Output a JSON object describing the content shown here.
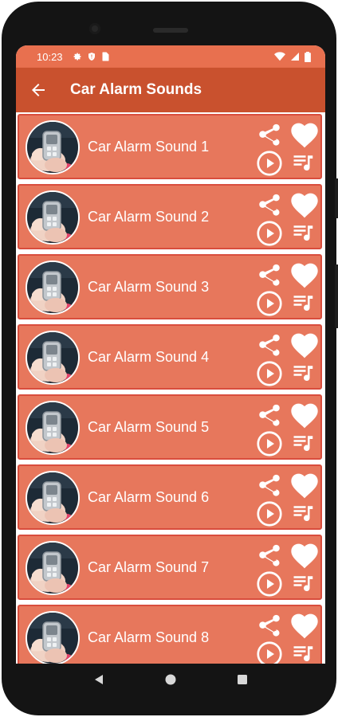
{
  "status_bar": {
    "time": "10:23",
    "left_icons": [
      "gear-icon",
      "shield-icon",
      "sim-card-icon"
    ],
    "right_icons": [
      "wifi-icon",
      "signal-icon",
      "battery-icon"
    ]
  },
  "app_bar": {
    "back_icon": "arrow-left-icon",
    "title": "Car Alarm Sounds"
  },
  "colors": {
    "status_bar": "#e8704f",
    "app_bar": "#c9512e",
    "item_background": "#e7775c",
    "item_border": "#d94d3d",
    "icon": "#ffffff"
  },
  "items": [
    {
      "title": "Car Alarm Sound 1"
    },
    {
      "title": "Car Alarm Sound 2"
    },
    {
      "title": "Car Alarm Sound 3"
    },
    {
      "title": "Car Alarm Sound 4"
    },
    {
      "title": "Car Alarm Sound 5"
    },
    {
      "title": "Car Alarm Sound 6"
    },
    {
      "title": "Car Alarm Sound 7"
    },
    {
      "title": "Car Alarm Sound 8"
    }
  ],
  "item_icons": [
    "share-icon",
    "play-icon",
    "heart-icon",
    "playlist-icon"
  ],
  "nav_bar": [
    "back-triangle-icon",
    "home-circle-icon",
    "recents-square-icon"
  ]
}
